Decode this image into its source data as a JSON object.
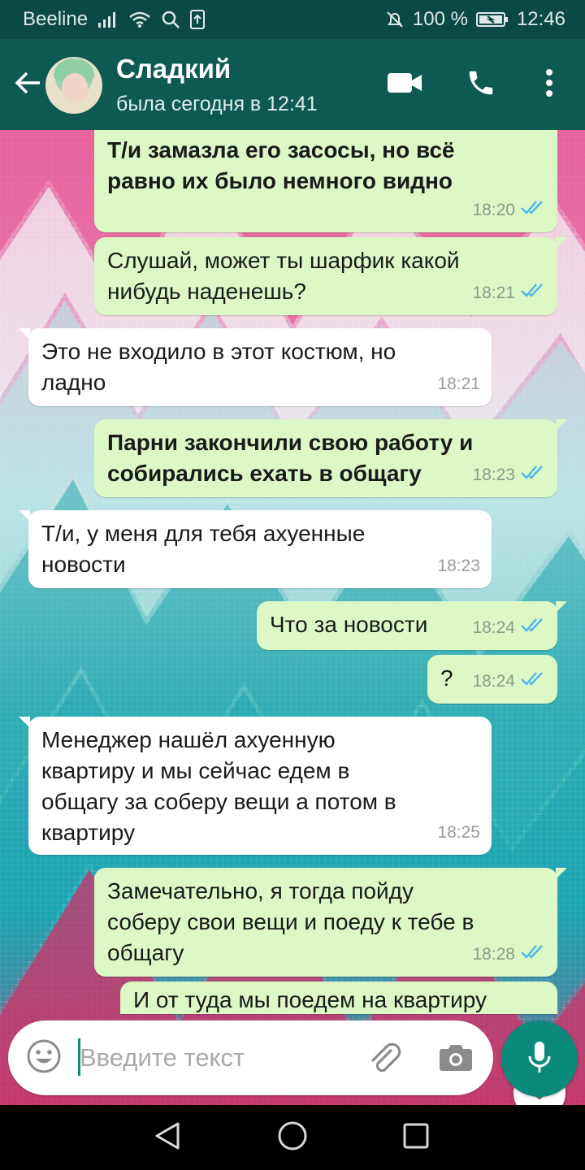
{
  "status_bar": {
    "carrier": "Beeline",
    "battery": "100 %",
    "time": "12:46"
  },
  "header": {
    "contact_name": "Сладкий",
    "last_seen": "была сегодня в 12:41"
  },
  "messages": [
    {
      "direction": "out",
      "bold": true,
      "text": "Т/и замазла его засосы, но всё\nравно их было немного видно",
      "time": "18:20",
      "read": true
    },
    {
      "direction": "out",
      "bold": false,
      "text": "Слушай, может ты шарфик какой\nнибудь наденешь?",
      "time": "18:21",
      "read": true
    },
    {
      "direction": "in",
      "bold": false,
      "text": "Это не входило в этот костюм, но\nладно",
      "time": "18:21"
    },
    {
      "direction": "out",
      "bold": true,
      "text": "Парни закончили свою работу и\nсобирались ехать в общагу",
      "time": "18:23",
      "read": true
    },
    {
      "direction": "in",
      "bold": false,
      "text": "Т/и, у меня для тебя ахуенные\nновости",
      "time": "18:23"
    },
    {
      "direction": "out",
      "bold": false,
      "text": "Что за новости",
      "time": "18:24",
      "read": true
    },
    {
      "direction": "out",
      "bold": false,
      "text": "?",
      "time": "18:24",
      "read": true
    },
    {
      "direction": "in",
      "bold": false,
      "text": "Менеджер нашёл ахуенную\nквартиру и мы сейчас едем в\nобщагу за соберу вещи а потом в\nквартиру",
      "time": "18:25"
    },
    {
      "direction": "out",
      "bold": false,
      "text": "Замечательно, я тогда пойду\nсоберу свои вещи и поеду к тебе в\nобщагу",
      "time": "18:28",
      "read": true
    },
    {
      "direction": "out",
      "bold": false,
      "text": "И от туда мы поедем на квартиру",
      "time": "",
      "read": false
    }
  ],
  "input": {
    "placeholder": "Введите текст"
  },
  "colors": {
    "header": "#0e5a52",
    "status_bar": "#0b4a44",
    "out_bubble": "#dcf8c6",
    "in_bubble": "#ffffff",
    "accent": "#0b8a7c",
    "read_ticks": "#4fb6ec"
  },
  "icons": {
    "back": "arrow-left-icon",
    "video": "video-camera-icon",
    "call": "phone-icon",
    "menu": "more-vertical-icon",
    "emoji": "emoji-icon",
    "attach": "paperclip-icon",
    "camera": "camera-icon",
    "mic": "microphone-icon",
    "scroll": "double-chevron-down-icon"
  }
}
